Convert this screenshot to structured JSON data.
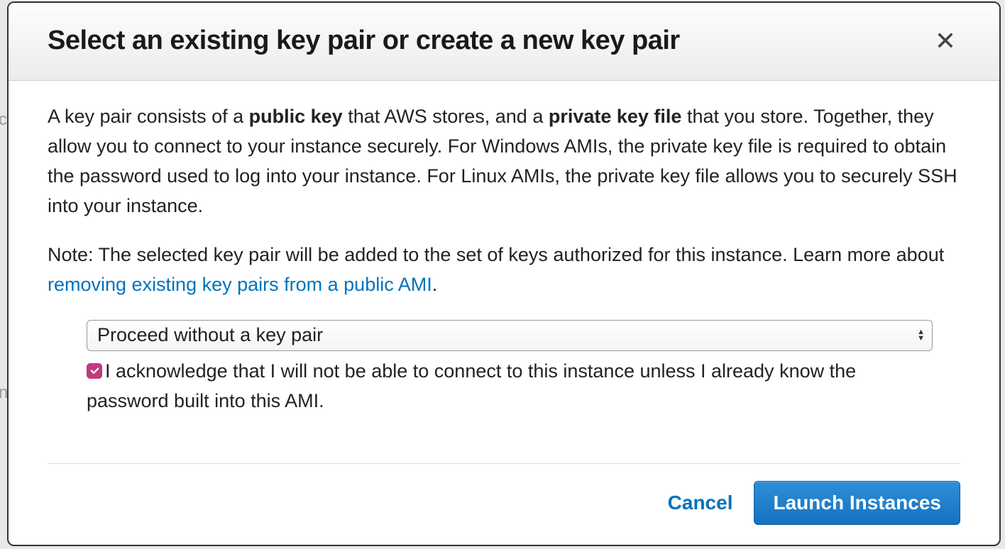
{
  "modal": {
    "title": "Select an existing key pair or create a new key pair",
    "body": {
      "p1_a": "A key pair consists of a ",
      "p1_b": "public key",
      "p1_c": " that AWS stores, and a ",
      "p1_d": "private key file",
      "p1_e": " that you store. Together, they allow you to connect to your instance securely. For Windows AMIs, the private key file is required to obtain the password used to log into your instance. For Linux AMIs, the private key file allows you to securely SSH into your instance.",
      "p2_a": "Note: The selected key pair will be added to the set of keys authorized for this instance. Learn more about ",
      "p2_link": "removing existing key pairs from a public AMI",
      "p2_b": "."
    },
    "select": {
      "value": "Proceed without a key pair"
    },
    "ack": {
      "checked": true,
      "text": "I acknowledge that I will not be able to connect to this instance unless I already know the password built into this AMI."
    },
    "footer": {
      "cancel": "Cancel",
      "launch": "Launch Instances"
    }
  }
}
